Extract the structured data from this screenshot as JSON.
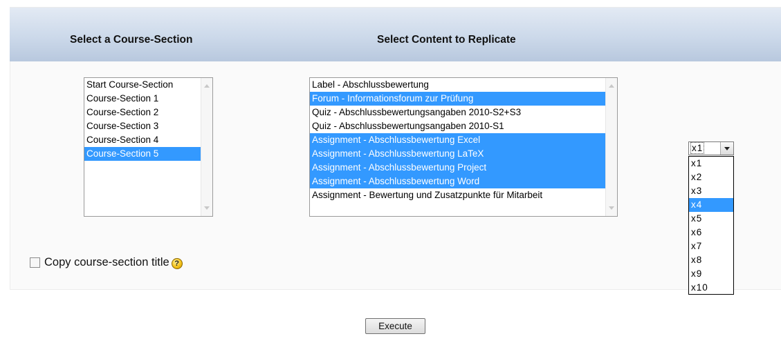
{
  "header": {
    "left_title": "Select a Course-Section",
    "right_title": "Select Content to Replicate"
  },
  "sections": {
    "items": [
      {
        "label": "Start Course-Section",
        "selected": false
      },
      {
        "label": "Course-Section 1",
        "selected": false
      },
      {
        "label": "Course-Section 2",
        "selected": false
      },
      {
        "label": "Course-Section 3",
        "selected": false
      },
      {
        "label": "Course-Section 4",
        "selected": false
      },
      {
        "label": "Course-Section 5",
        "selected": true
      }
    ]
  },
  "content": {
    "items": [
      {
        "label": "Label - Abschlussbewertung",
        "selected": false
      },
      {
        "label": "Forum - Informationsforum zur Prüfung",
        "selected": true
      },
      {
        "label": "Quiz - Abschlussbewertungsangaben 2010-S2+S3",
        "selected": false
      },
      {
        "label": "Quiz - Abschlussbewertungsangaben 2010-S1",
        "selected": false
      },
      {
        "label": "Assignment - Abschlussbewertung Excel",
        "selected": true
      },
      {
        "label": "Assignment - Abschlussbewertung LaTeX",
        "selected": true
      },
      {
        "label": "Assignment - Abschlussbewertung Project",
        "selected": true
      },
      {
        "label": "Assignment - Abschlussbewertung Word",
        "selected": true
      },
      {
        "label": "Assignment - Bewertung und Zusatzpunkte für Mitarbeit",
        "selected": false
      }
    ]
  },
  "copy_title": {
    "label": "Copy course-section title",
    "checked": false,
    "help_icon": "help-icon",
    "help_glyph": "?"
  },
  "multiplier": {
    "value": "x1",
    "options": [
      "x1",
      "x2",
      "x3",
      "x4",
      "x5",
      "x6",
      "x7",
      "x8",
      "x9",
      "x10"
    ],
    "highlighted": "x4"
  },
  "execute_label": "Execute",
  "colors": {
    "selection": "#3399ff",
    "header_gradient_top": "#e3eaf4",
    "header_gradient_bottom": "#b8c8de"
  }
}
